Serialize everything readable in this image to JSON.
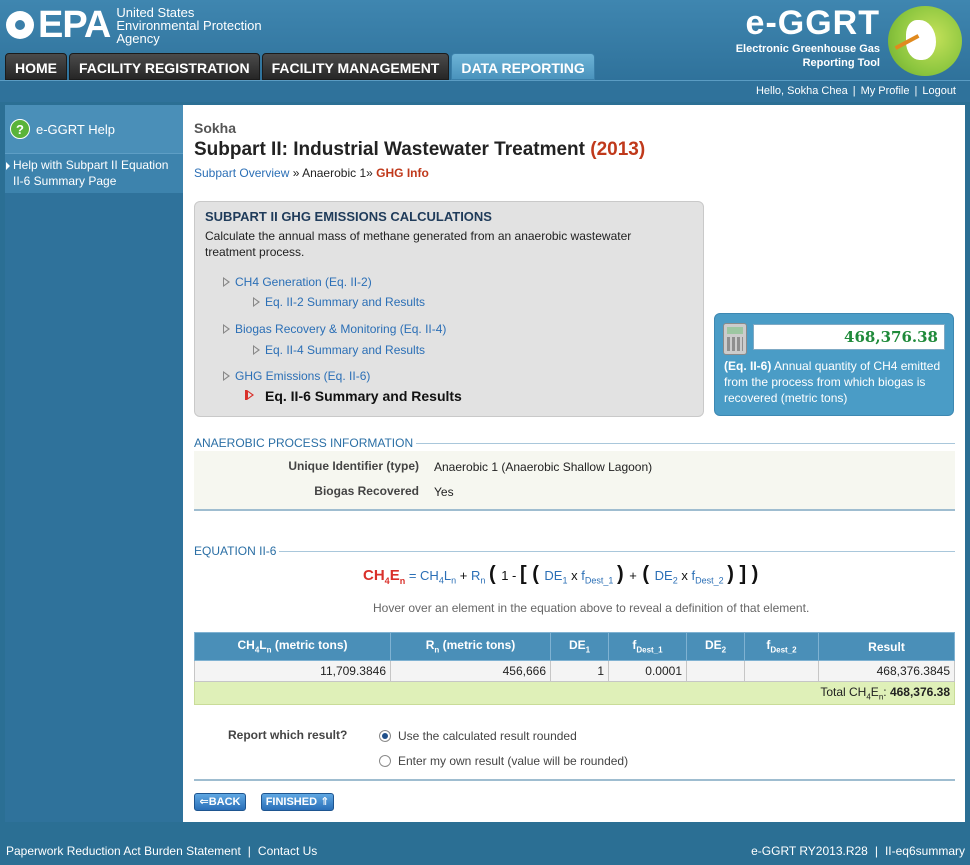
{
  "header": {
    "epa_mark": "EPA",
    "agency_lines": [
      "United States",
      "Environmental Protection",
      "Agency"
    ],
    "brand": "e-GGRT",
    "brand_sub_1": "Electronic Greenhouse Gas",
    "brand_sub_2": "Reporting Tool"
  },
  "nav": {
    "tabs": [
      {
        "label": "HOME",
        "active": false
      },
      {
        "label": "FACILITY REGISTRATION",
        "active": false
      },
      {
        "label": "FACILITY MANAGEMENT",
        "active": false
      },
      {
        "label": "DATA REPORTING",
        "active": true
      }
    ]
  },
  "userbar": {
    "greeting": "Hello, Sokha Chea",
    "profile": "My Profile",
    "logout": "Logout"
  },
  "sidebar": {
    "help_title": "e-GGRT Help",
    "help_link": "Help with Subpart II Equation II-6 Summary Page"
  },
  "main": {
    "facility": "Sokha",
    "title": "Subpart II: Industrial Wastewater Treatment",
    "year": "(2013)",
    "breadcrumb": {
      "overview": "Subpart Overview",
      "sep1": "»",
      "current_unit": "Anaerobic 1",
      "sep2": "»",
      "current": "GHG Info"
    }
  },
  "calc": {
    "title": "SUBPART II GHG EMISSIONS CALCULATIONS",
    "description": "Calculate the annual mass of methane generated from an anaerobic wastewater treatment process.",
    "items": [
      {
        "label": "CH4 Generation (Eq. II-2)"
      },
      {
        "label": "Eq. II-2 Summary and Results"
      },
      {
        "label": "Biogas Recovery & Monitoring (Eq. II-4)"
      },
      {
        "label": "Eq. II-4 Summary and Results"
      },
      {
        "label": "GHG Emissions (Eq. II-6)"
      },
      {
        "label": "Eq. II-6 Summary and Results"
      }
    ]
  },
  "result_box": {
    "value": "468,376.38",
    "eq": "(Eq. II-6)",
    "desc": "Annual quantity of CH4 emitted from the process from which biogas is recovered (metric tons)"
  },
  "anaerobic": {
    "heading": "ANAEROBIC PROCESS INFORMATION",
    "uid_label": "Unique Identifier (type)",
    "uid_value": "Anaerobic 1 (Anaerobic Shallow Lagoon)",
    "biogas_label": "Biogas Recovered",
    "biogas_value": "Yes"
  },
  "equation": {
    "heading": "EQUATION II-6",
    "hint": "Hover over an element in the equation above to reveal a definition of that element."
  },
  "table": {
    "headers": {
      "col1": "CH4Ln (metric tons)",
      "col2": "Rn (metric tons)",
      "col3": "DE1",
      "col4": "fDest_1",
      "col5": "DE2",
      "col6": "fDest_2",
      "col7": "Result"
    },
    "row": {
      "ch4ln": "11,709.3846",
      "rn": "456,666",
      "de1": "1",
      "fdest1": "0.0001",
      "de2": "",
      "fdest2": "",
      "result": "468,376.3845"
    },
    "total_label": "Total CH4En:",
    "total_value": "468,376.38"
  },
  "report": {
    "question": "Report which result?",
    "option1": "Use the calculated result rounded",
    "option2": "Enter my own result (value will be rounded)",
    "selected": "option1"
  },
  "buttons": {
    "back": "BACK",
    "finished": "FINISHED"
  },
  "footer": {
    "paperwork": "Paperwork Reduction Act Burden Statement",
    "contact": "Contact Us",
    "version": "e-GGRT RY2013.R28",
    "page_id": "II-eq6summary"
  },
  "colors": {
    "header_blue": "#2f729b",
    "link_blue": "#2b6fb6",
    "accent_red": "#c0391b",
    "result_green": "#1f8a3a"
  }
}
